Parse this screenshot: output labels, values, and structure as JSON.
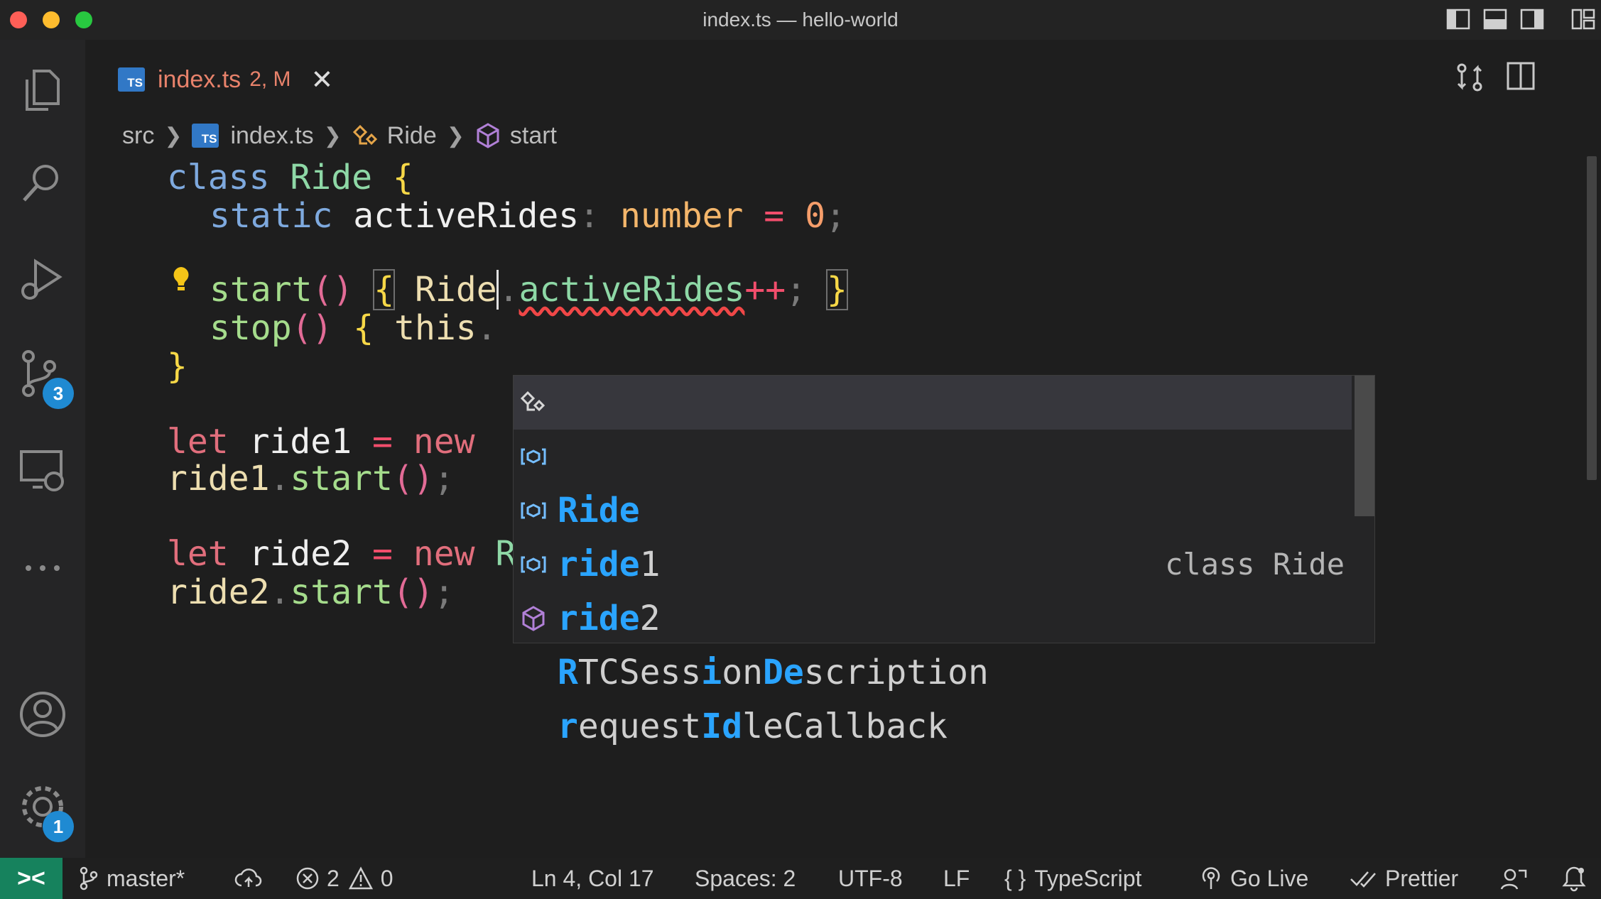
{
  "window": {
    "title": "index.ts — hello-world"
  },
  "colors": {
    "accent": "#1f8ad2",
    "remote": "#16825d",
    "error": "#f04747",
    "tab_modified": "#e8826b"
  },
  "activity_bar": {
    "items": [
      "explorer-icon",
      "search-icon",
      "run-debug-icon",
      "source-control-icon",
      "remote-explorer-icon",
      "more-icon"
    ],
    "source_control_badge": "3",
    "bottom": [
      "accounts-icon",
      "manage-gear-icon"
    ],
    "manage_badge": "1"
  },
  "tab": {
    "lang_badge": "TS",
    "name": "index.ts",
    "status": "2, M",
    "close": "✕"
  },
  "breadcrumb": {
    "folder": "src",
    "file": "index.ts",
    "class": "Ride",
    "method": "start",
    "lang_badge": "TS"
  },
  "code": {
    "l1": {
      "kw": "class",
      "name": "Ride",
      "brace": "{"
    },
    "l2": {
      "kw": "static",
      "prop": "activeRides",
      "colon": ":",
      "type": "number",
      "eq": "=",
      "num": "0",
      "semi": ";"
    },
    "l4": {
      "fn": "start",
      "parens": "()",
      "open": "{",
      "obj": "Ride",
      "dot": ".",
      "prop": "activeRides",
      "op": "++",
      "semi": ";",
      "close": "}"
    },
    "l5": {
      "fn": "stop",
      "parens": "()",
      "open": "{",
      "obj": "this",
      "dot": "."
    },
    "l6": {
      "close": "}"
    },
    "l8": {
      "kw": "let",
      "var": "ride1",
      "eq": "=",
      "new": "new"
    },
    "l9": {
      "var": "ride1",
      "dot": ".",
      "fn": "start",
      "parens": "()",
      "semi": ";"
    },
    "l11": {
      "kw": "let",
      "var": "ride2",
      "eq": "=",
      "new": "new",
      "cls": "Ride",
      "parens": "()",
      "semi": ";"
    },
    "l12": {
      "var": "ride2",
      "dot": ".",
      "fn": "start",
      "parens": "()",
      "semi": ";"
    }
  },
  "suggest": {
    "items": [
      {
        "icon": "class-icon",
        "label": "Ride",
        "detail": "class Ride"
      },
      {
        "icon": "variable-icon",
        "label": "ride1",
        "hl": "ride",
        "rest": "1"
      },
      {
        "icon": "variable-icon",
        "label": "ride2",
        "hl": "ride",
        "rest": "2"
      },
      {
        "icon": "variable-icon",
        "label": "RTCSessionDescription",
        "parts": [
          "R",
          "TCSess",
          "i",
          "on",
          "De",
          "scription"
        ]
      },
      {
        "icon": "method-icon",
        "label": "requestIdleCallback",
        "parts": [
          "r",
          "equest",
          "Id",
          "le",
          "Callback"
        ]
      }
    ]
  },
  "status_bar": {
    "branch": "master*",
    "errors": "2",
    "warnings": "0",
    "position": "Ln 4, Col 17",
    "spaces": "Spaces: 2",
    "encoding": "UTF-8",
    "eol": "LF",
    "language": "TypeScript",
    "go_live": "Go Live",
    "prettier": "Prettier"
  }
}
